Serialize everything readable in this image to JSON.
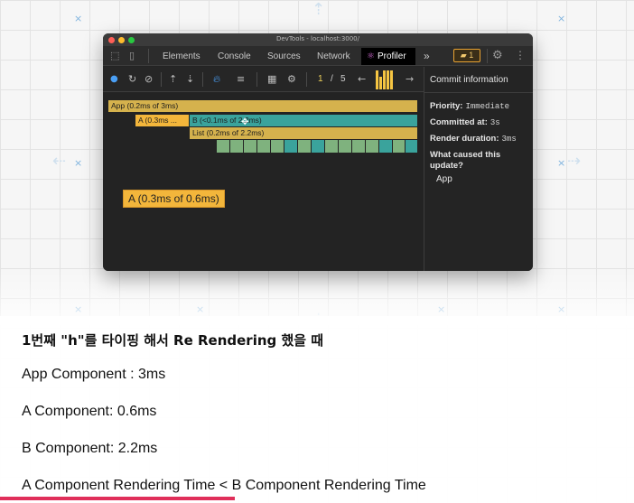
{
  "window": {
    "title": "DevTools - localhost:3000/"
  },
  "tabs": {
    "elements": "Elements",
    "console": "Console",
    "sources": "Sources",
    "network": "Network",
    "profiler": "Profiler",
    "more": "»",
    "issues_count": "1"
  },
  "toolbar": {
    "commit_current": "1",
    "commit_separator": "/",
    "commit_total": "5"
  },
  "flamegraph": {
    "app": "App (0.2ms of 3ms)",
    "a": "A (0.3ms ...",
    "b": "B (<0.1ms of 2.2ms)",
    "list": "List (0.2ms of 2.2ms)",
    "tooltip": "A (0.3ms of 0.6ms)",
    "colors": {
      "gold": "#d5b24d",
      "teal": "#3aa39c",
      "green": "#7fb27e",
      "orange": "#f3b63b"
    }
  },
  "commit_info": {
    "title": "Commit information",
    "priority_label": "Priority:",
    "priority_value": "Immediate",
    "committed_label": "Committed at:",
    "committed_value": "3s",
    "duration_label": "Render duration:",
    "duration_value": "3ms",
    "cause_question": "What caused this update?",
    "cause_answer": "App"
  },
  "notes": {
    "heading": "1번째 \"h\"를 타이핑 해서 Re Rendering 했을 때",
    "line1": "App Component : 3ms",
    "line2": "A Component: 0.6ms",
    "line3": "B Component: 2.2ms",
    "line4": "A Component Rendering Time < B Component Rendering Time"
  },
  "video_progress": 0.37
}
